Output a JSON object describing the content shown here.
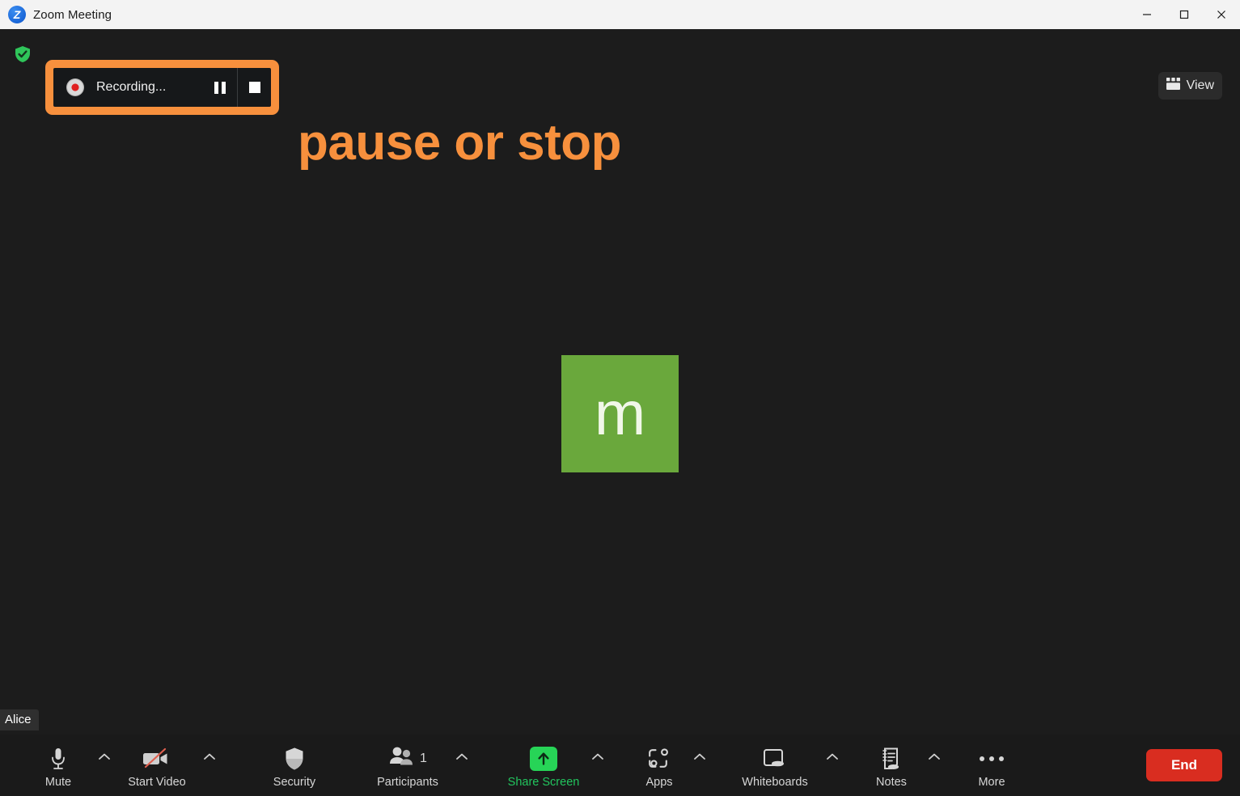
{
  "window": {
    "title": "Zoom Meeting",
    "logo_icon": "zoom-logo-icon",
    "logo_letter": "Z",
    "controls": {
      "minimize": "minimize-icon",
      "maximize": "maximize-icon",
      "close": "close-icon"
    }
  },
  "stage": {
    "shield_icon": "shield-check-icon",
    "annotation_text": "pause or stop",
    "annotation_color": "#f7903d",
    "highlight_color": "#f7903d",
    "recording": {
      "status_label": "Recording...",
      "record_dot_icon": "record-dot-icon",
      "pause_icon": "pause-icon",
      "stop_icon": "stop-icon"
    },
    "view": {
      "label": "View",
      "icon": "grid-view-icon"
    },
    "participant_tile": {
      "avatar_letter": "m",
      "avatar_color": "#6aa83c",
      "name": "Alice"
    }
  },
  "toolbar": {
    "items": [
      {
        "label": "Mute",
        "icon": "microphone-icon",
        "caret": true,
        "accent": false
      },
      {
        "label": "Start Video",
        "icon": "camera-off-icon",
        "caret": true,
        "accent": false
      },
      {
        "label": "Security",
        "icon": "shield-icon",
        "caret": false,
        "accent": false
      },
      {
        "label": "Participants",
        "icon": "people-icon",
        "caret": true,
        "accent": false,
        "count": "1"
      },
      {
        "label": "Share Screen",
        "icon": "share-arrow-icon",
        "caret": true,
        "accent": true
      },
      {
        "label": "Apps",
        "icon": "apps-icon",
        "caret": true,
        "accent": false
      },
      {
        "label": "Whiteboards",
        "icon": "whiteboard-icon",
        "caret": true,
        "accent": false
      },
      {
        "label": "Notes",
        "icon": "notes-icon",
        "caret": true,
        "accent": false
      },
      {
        "label": "More",
        "icon": "more-dots-icon",
        "caret": false,
        "accent": false
      }
    ],
    "end_label": "End",
    "end_color": "#d92d20"
  }
}
